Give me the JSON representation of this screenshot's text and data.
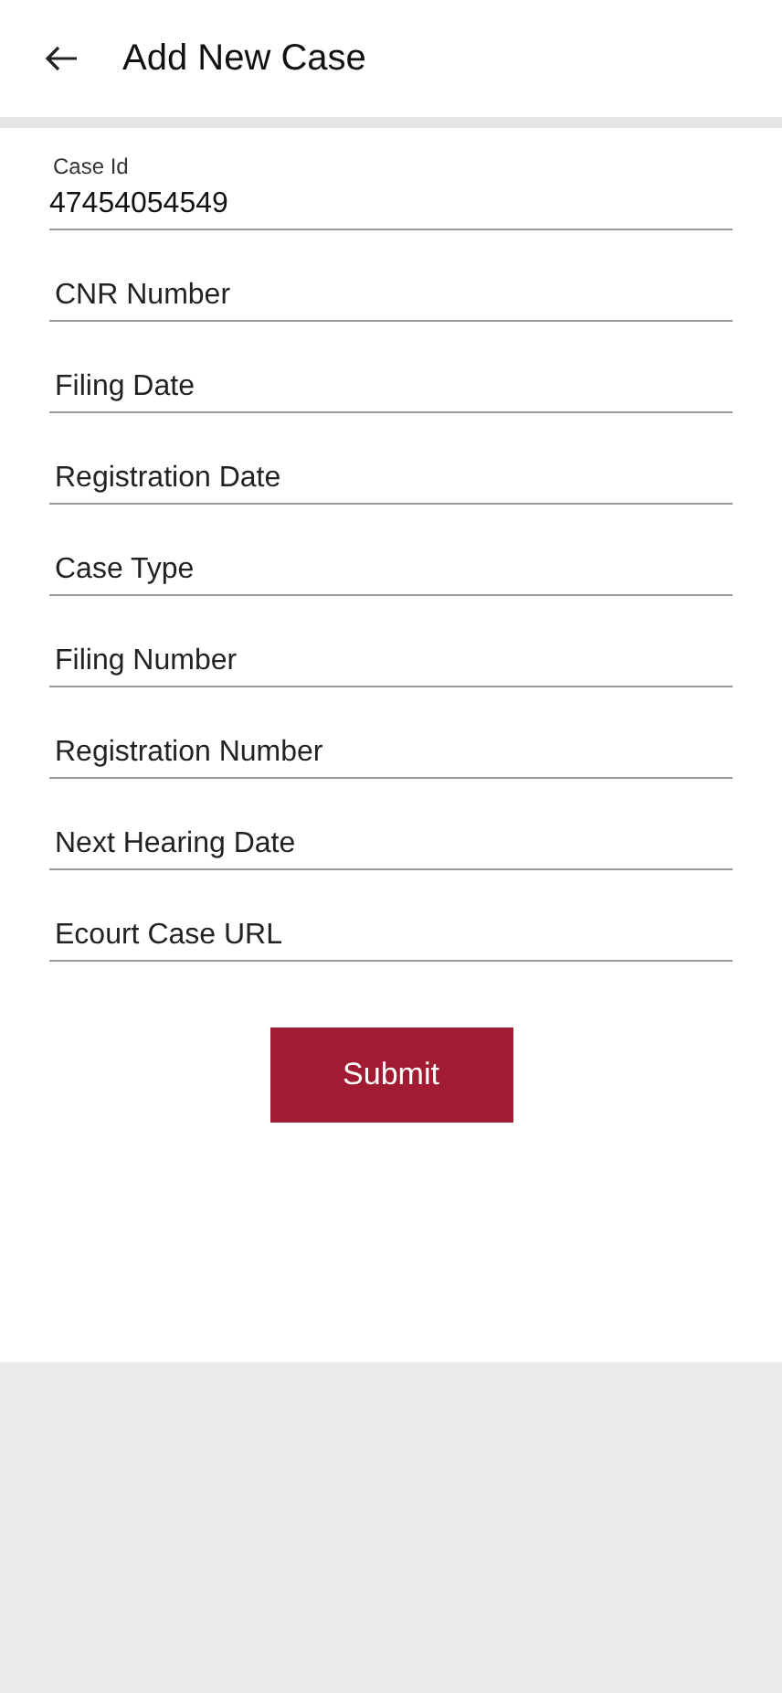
{
  "header": {
    "title": "Add New Case"
  },
  "case_id": {
    "label": "Case Id",
    "value": "47454054549"
  },
  "fields": [
    {
      "placeholder": "CNR Number"
    },
    {
      "placeholder": "Filing Date"
    },
    {
      "placeholder": "Registration Date"
    },
    {
      "placeholder": "Case Type"
    },
    {
      "placeholder": "Filing Number"
    },
    {
      "placeholder": "Registration Number"
    },
    {
      "placeholder": "Next Hearing Date"
    },
    {
      "placeholder": "Ecourt Case URL"
    }
  ],
  "submit": {
    "label": "Submit"
  }
}
